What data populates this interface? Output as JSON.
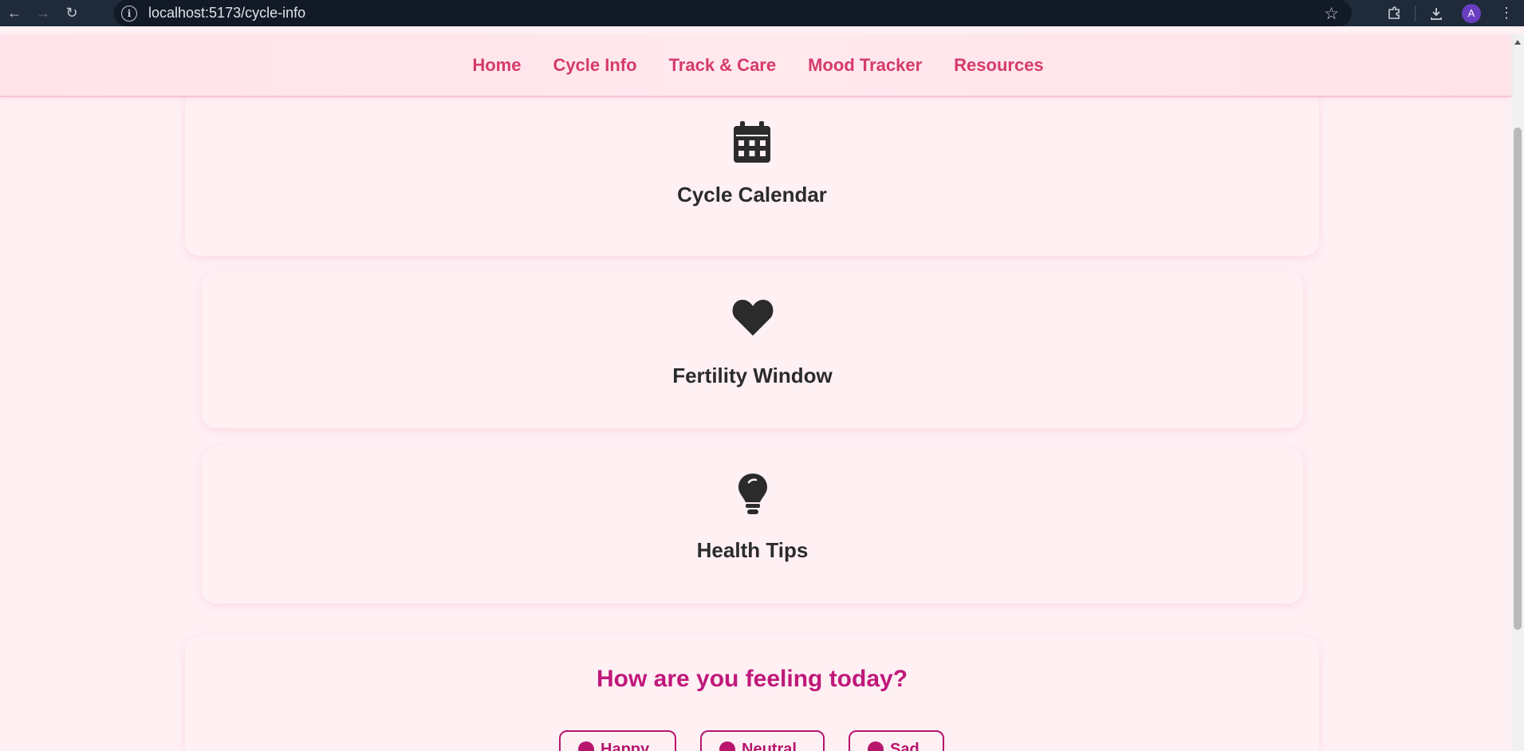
{
  "browser": {
    "url": "localhost:5173/cycle-info",
    "avatar_letter": "A"
  },
  "nav": {
    "items": [
      "Home",
      "Cycle Info",
      "Track & Care",
      "Mood Tracker",
      "Resources"
    ],
    "color": "#d63a6c"
  },
  "cards": [
    {
      "label": "Cycle Calendar",
      "icon": "calendar-icon"
    },
    {
      "label": "Fertility Window",
      "icon": "heart-icon"
    },
    {
      "label": "Health Tips",
      "icon": "lightbulb-icon"
    }
  ],
  "mood": {
    "title": "How are you feeling today?",
    "options": [
      "Happy",
      "Neutral",
      "Sad"
    ],
    "accent": "#c0187a"
  }
}
